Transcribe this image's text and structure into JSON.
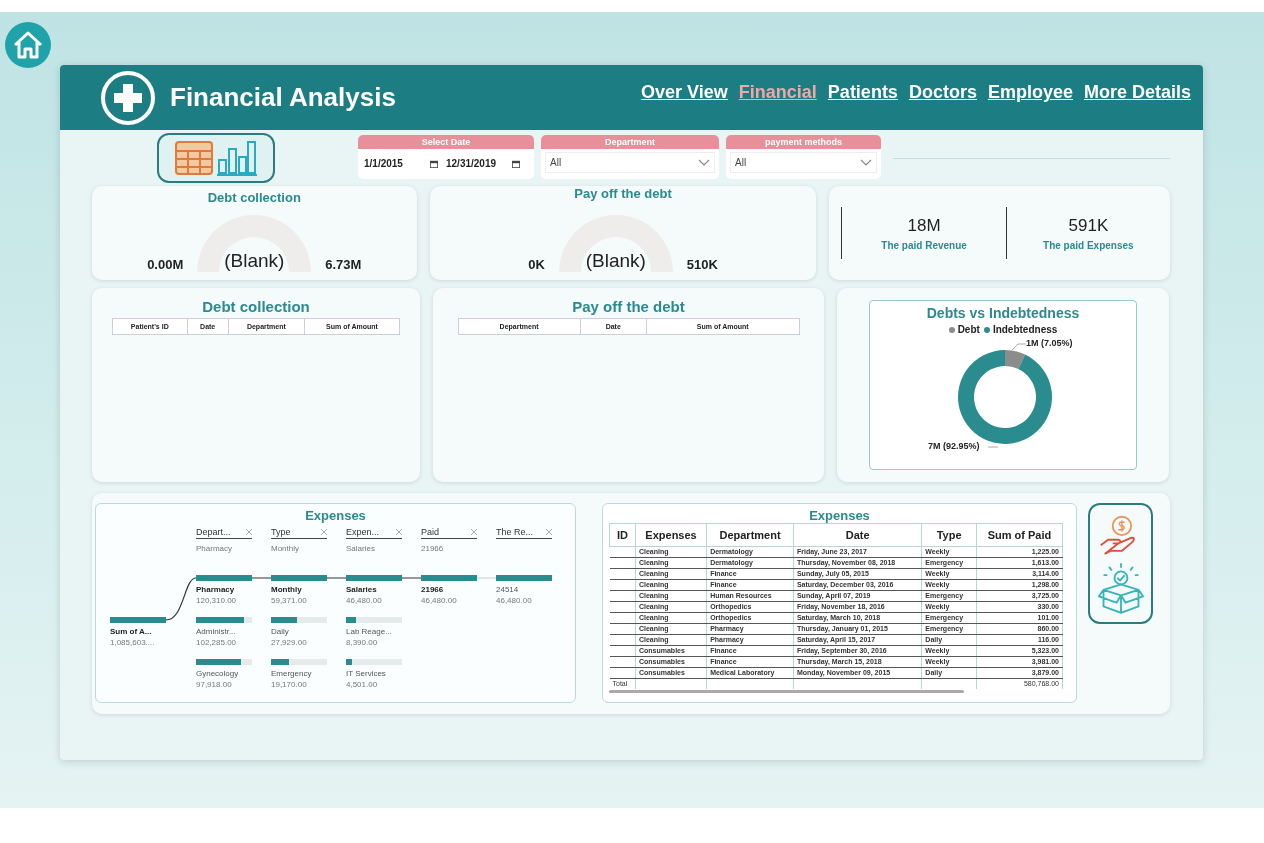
{
  "header": {
    "title": "Financial Analysis",
    "nav": [
      {
        "label": "Over View",
        "selected": false
      },
      {
        "label": "Financial",
        "selected": true
      },
      {
        "label": "Patients",
        "selected": false
      },
      {
        "label": "Doctors",
        "selected": false
      },
      {
        "label": "Employee",
        "selected": false
      },
      {
        "label": "More Details",
        "selected": false
      }
    ]
  },
  "filters": {
    "date": {
      "label": "Select Date",
      "start": "1/1/2015",
      "end": "12/31/2019"
    },
    "dropdowns": [
      {
        "label": "Department",
        "value": "All"
      },
      {
        "label": "payment methods",
        "value": "All"
      }
    ]
  },
  "gauges": [
    {
      "title": "Debt collection",
      "value": "(Blank)",
      "min": "0.00M",
      "max": "6.73M"
    },
    {
      "title": "Pay off the debt",
      "value": "(Blank)",
      "min": "0K",
      "max": "510K"
    }
  ],
  "kpis": [
    {
      "value": "18M",
      "label": "The paid Revenue"
    },
    {
      "value": "591K",
      "label": "The paid Expenses"
    }
  ],
  "debt_tables": [
    {
      "title": "Debt collection",
      "columns": [
        "Patient's ID",
        "Date",
        "Department",
        "Sum of Amount"
      ]
    },
    {
      "title": "Pay off the debt",
      "columns": [
        "Department",
        "Date",
        "Sum of Amount"
      ]
    }
  ],
  "donut": {
    "title": "Debts vs Indebtedness",
    "chart_data": {
      "type": "donut",
      "categories": [
        "Debt",
        "Indebtedness"
      ],
      "values": [
        7.05,
        92.95
      ],
      "colors": [
        "#8c8c8c",
        "#2a8c8f"
      ],
      "value_labels": [
        "1M (7.05%)",
        "7M (92.95%)"
      ]
    }
  },
  "decomposition_tree": {
    "title": "Expenses",
    "root": {
      "name": "Sum of A...",
      "value": "1,085,603....",
      "level": 1
    },
    "columns": [
      {
        "header": "Depart...",
        "filter": "Pharmacy",
        "nodes": [
          {
            "name": "Pharmacy",
            "value": "120,310.00",
            "level": 1,
            "selected": true
          },
          {
            "name": "Administr...",
            "value": "102,285.00",
            "level": 0.85,
            "selected": false
          },
          {
            "name": "Gynecology",
            "value": "97,918.00",
            "level": 0.8,
            "selected": false
          }
        ]
      },
      {
        "header": "Type",
        "filter": "Monthly",
        "nodes": [
          {
            "name": "Monthly",
            "value": "59,371.00",
            "level": 1,
            "selected": true
          },
          {
            "name": "Daily",
            "value": "27,929.00",
            "level": 0.47,
            "selected": false
          },
          {
            "name": "Emergency",
            "value": "19,170.00",
            "level": 0.32,
            "selected": false
          }
        ]
      },
      {
        "header": "Expen...",
        "filter": "Salaries",
        "nodes": [
          {
            "name": "Salaries",
            "value": "46,480.00",
            "level": 1,
            "selected": true
          },
          {
            "name": "Lab Reage...",
            "value": "8,390.00",
            "level": 0.18,
            "selected": false
          },
          {
            "name": "IT Services",
            "value": "4,501.00",
            "level": 0.1,
            "selected": false
          }
        ]
      },
      {
        "header": "Paid",
        "filter": "21966",
        "nodes": [
          {
            "name": "21966",
            "value": "46,480.00",
            "level": 1,
            "selected": true
          }
        ]
      },
      {
        "header": "The Re...",
        "nodes": [
          {
            "name": "24514",
            "value": "46,480.00",
            "level": 1,
            "selected": false
          }
        ]
      }
    ]
  },
  "expenses_table": {
    "title": "Expenses",
    "columns": [
      "ID",
      "Expenses",
      "Department",
      "Date",
      "Type",
      "Sum of Paid"
    ],
    "rows": [
      [
        "",
        "Cleaning",
        "Dermatology",
        "Friday, June 23, 2017",
        "Weekly",
        "1,225.00"
      ],
      [
        "",
        "Cleaning",
        "Dermatology",
        "Thursday, November 08, 2018",
        "Emergency",
        "1,613.00"
      ],
      [
        "",
        "Cleaning",
        "Finance",
        "Sunday, July 05, 2015",
        "Weekly",
        "3,114.00"
      ],
      [
        "",
        "Cleaning",
        "Finance",
        "Saturday, December 03, 2016",
        "Weekly",
        "1,298.00"
      ],
      [
        "",
        "Cleaning",
        "Human Resources",
        "Sunday, April 07, 2019",
        "Emergency",
        "3,725.00"
      ],
      [
        "",
        "Cleaning",
        "Orthopedics",
        "Friday, November 18, 2016",
        "Weekly",
        "330.00"
      ],
      [
        "",
        "Cleaning",
        "Orthopedics",
        "Saturday, March 10, 2018",
        "Emergency",
        "101.00"
      ],
      [
        "",
        "Cleaning",
        "Pharmacy",
        "Thursday, January 01, 2015",
        "Emergency",
        "860.00"
      ],
      [
        "",
        "Cleaning",
        "Pharmacy",
        "Saturday, April 15, 2017",
        "Daily",
        "116.00"
      ],
      [
        "",
        "Consumables",
        "Finance",
        "Friday, September 30, 2016",
        "Weekly",
        "5,323.00"
      ],
      [
        "",
        "Consumables",
        "Finance",
        "Thursday, March 15, 2018",
        "Weekly",
        "3,981.00"
      ],
      [
        "",
        "Consumables",
        "Medical Laboratory",
        "Monday, November 09, 2015",
        "Daily",
        "3,879.00"
      ]
    ],
    "total": {
      "label": "Total",
      "value": "580,768.00"
    }
  }
}
